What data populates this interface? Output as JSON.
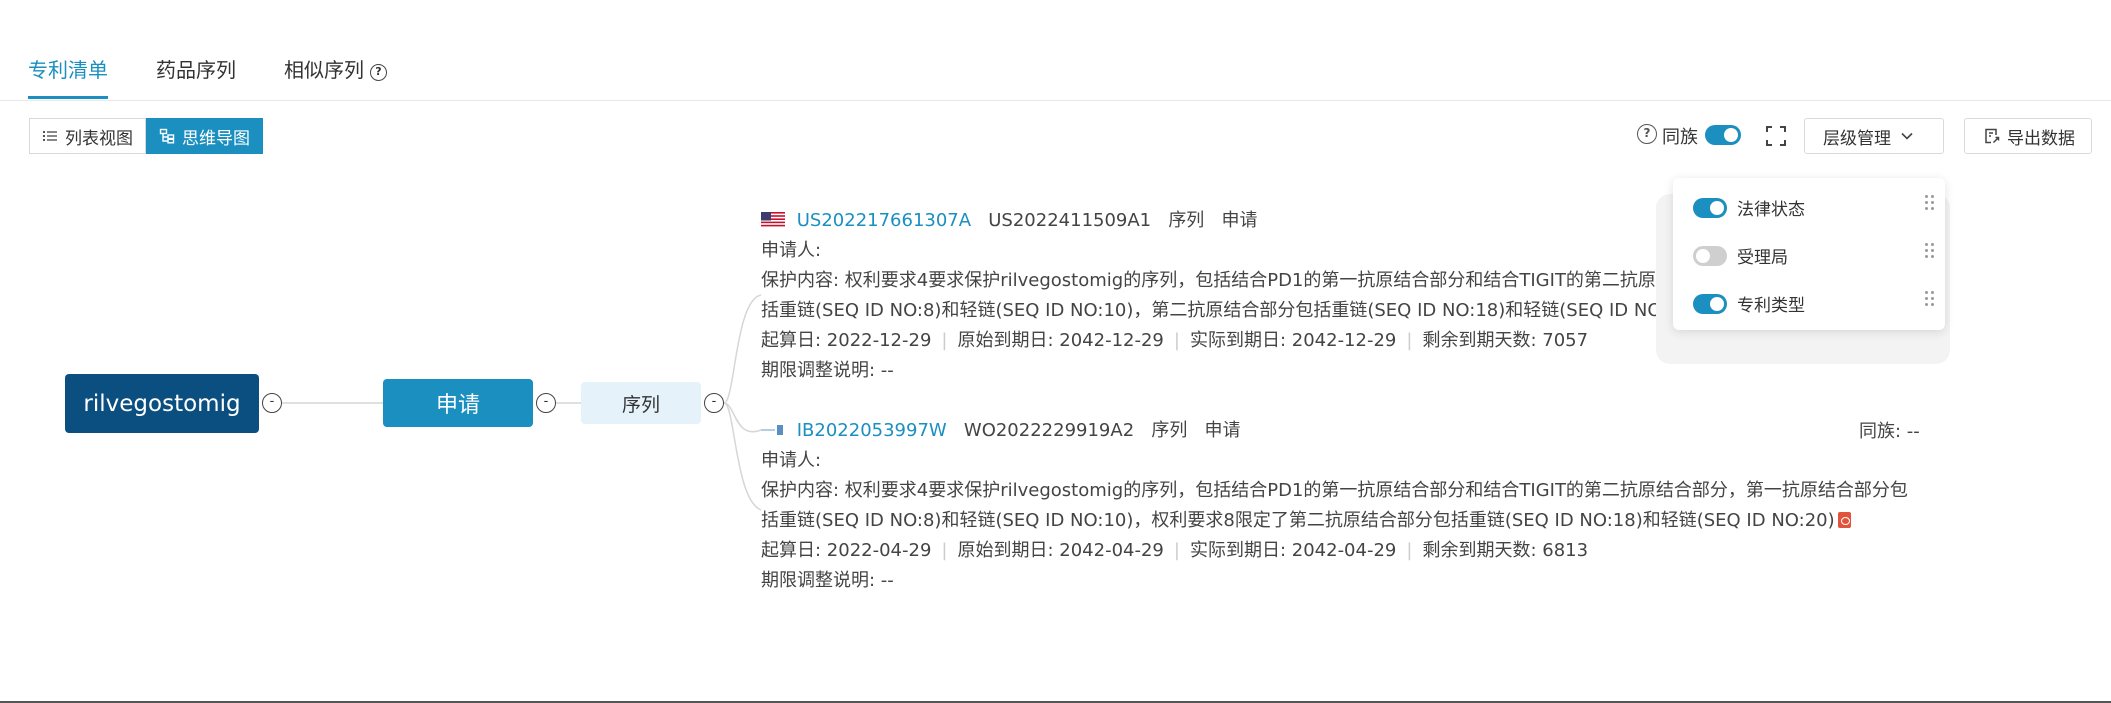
{
  "tabs": [
    {
      "label": "专利清单",
      "active": true
    },
    {
      "label": "药品序列",
      "active": false
    },
    {
      "label": "相似序列",
      "active": false
    }
  ],
  "view_switch": {
    "list_label": "列表视图",
    "mindmap_label": "思维导图"
  },
  "toolbar": {
    "help_icon_text": "?",
    "family_label": "同族",
    "family_toggle_on": true,
    "level_label": "层级管理",
    "export_label": "导出数据"
  },
  "level_panel": {
    "items": [
      {
        "label": "法律状态",
        "enabled": true
      },
      {
        "label": "受理局",
        "enabled": false
      },
      {
        "label": "专利类型",
        "enabled": true
      }
    ]
  },
  "mindmap": {
    "root": "rilvegostomig",
    "level1": "申请",
    "level2": "序列",
    "collapse_symbol": "-"
  },
  "cards": [
    {
      "flag": "us-flag-icon",
      "patent_no": "US202217661307A",
      "pub_no": "US2022411509A1",
      "tag1": "序列",
      "tag2": "申请",
      "applicant": "申请人:",
      "content_line1": "保护内容:  权利要求4要求保护rilvegostomig的序列，包括结合PD1的第一抗原结合部分和结合TIGIT的第二抗原结合",
      "content_line2": "括重链(SEQ ID NO:8)和轻链(SEQ ID NO:10)，第二抗原结合部分包括重链(SEQ ID NO:18)和轻链(SEQ ID NO:20)",
      "dates": [
        "起算日:  2022-12-29",
        "原始到期日:  2042-12-29",
        "实际到期日:  2042-12-29",
        "剩余到期天数:  7057"
      ],
      "adjust": "期限调整说明:  --"
    },
    {
      "flag": "wo-flag-icon",
      "patent_no": "IB2022053997W",
      "pub_no": "WO2022229919A2",
      "tag1": "序列",
      "tag2": "申请",
      "family": "同族: --",
      "applicant": "申请人:",
      "content_line1": "保护内容:  权利要求4要求保护rilvegostomig的序列，包括结合PD1的第一抗原结合部分和结合TIGIT的第二抗原结合部分，第一抗原结合部分包",
      "content_line2": "括重链(SEQ ID NO:8)和轻链(SEQ ID NO:10)，权利要求8限定了第二抗原结合部分包括重链(SEQ ID NO:18)和轻链(SEQ ID NO:20)",
      "dates": [
        "起算日:  2022-04-29",
        "原始到期日:  2042-04-29",
        "实际到期日:  2042-04-29",
        "剩余到期天数:  6813"
      ],
      "adjust": "期限调整说明:  --"
    }
  ],
  "colors": {
    "accent": "#1a8fc0",
    "root_node": "#0a4f80",
    "seq_node": "#e6f2f9"
  }
}
